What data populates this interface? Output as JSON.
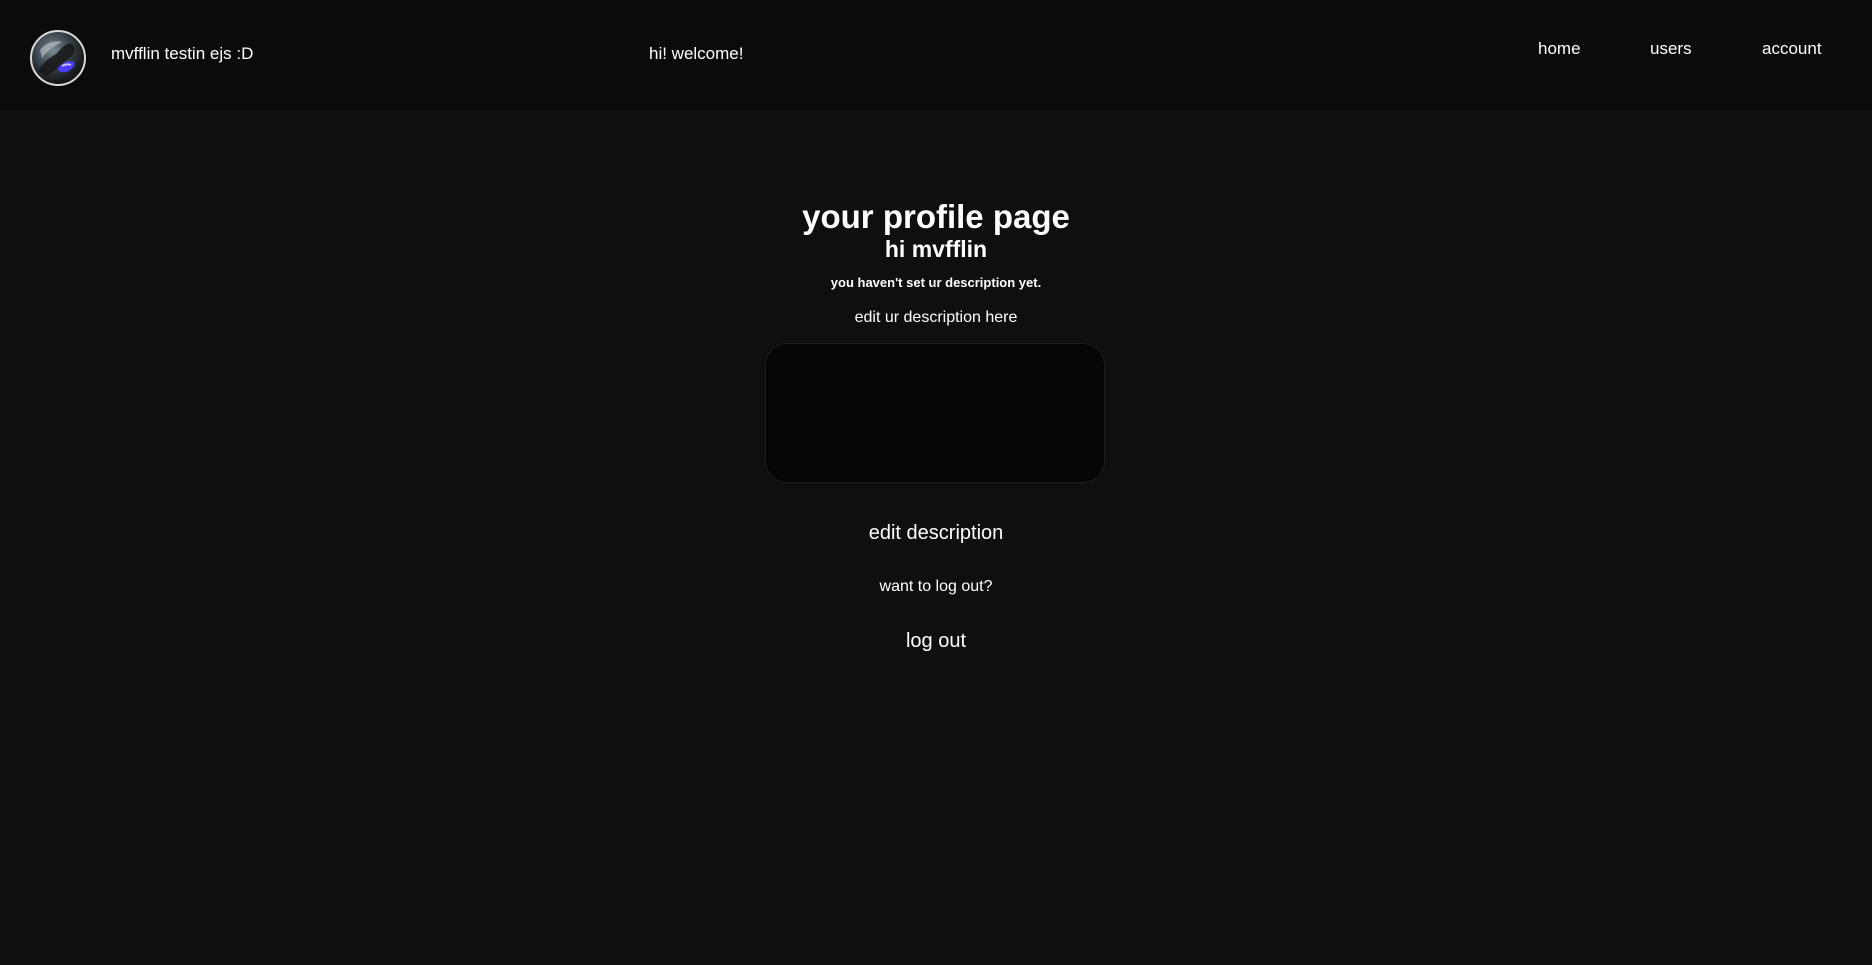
{
  "header": {
    "site_title": "mvfflin testin ejs :D",
    "welcome": "hi! welcome!",
    "nav": {
      "home": "home",
      "users": "users",
      "account": "account"
    }
  },
  "profile": {
    "title": "your profile page",
    "greeting": "hi mvfflin",
    "description_status": "you haven't set ur description yet.",
    "edit_label": "edit ur description here",
    "description_value": "",
    "edit_button": "edit description",
    "logout_prompt": "want to log out?",
    "logout_button": "log out"
  },
  "colors": {
    "page_background": "#0f0f0f",
    "header_background": "#0b0b0b",
    "text": "#ffffff",
    "textarea_background": "#060606"
  }
}
